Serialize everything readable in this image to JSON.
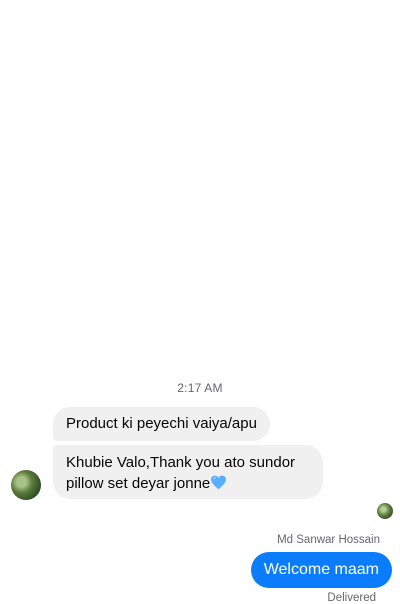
{
  "conversation": {
    "timestamp": "2:17 AM",
    "incoming": [
      {
        "text": "Product ki peyechi vaiya/apu"
      },
      {
        "text": "Khubie Valo,Thank you ato sundor pillow set deyar jonne"
      }
    ],
    "outgoing": {
      "sender_name": "Md Sanwar Hossain",
      "text": "Welcome maam",
      "status": "Delivered"
    }
  },
  "colors": {
    "outgoing_bubble": "#0b7dfc",
    "incoming_bubble": "#f0f0f0",
    "heart_emoji": "#5aaeff"
  },
  "icons": {
    "emoji": "blue-heart-icon"
  }
}
